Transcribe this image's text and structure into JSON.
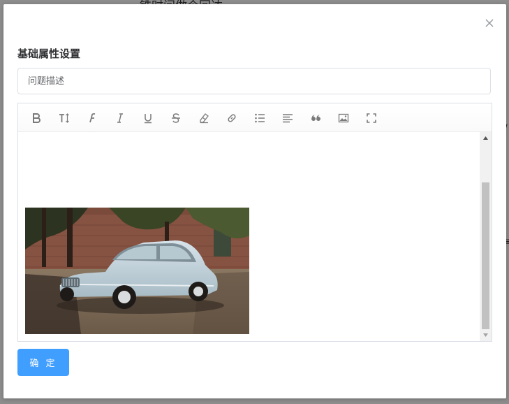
{
  "background": {
    "partial_text": "..."
  },
  "dialog": {
    "title": "基础属性设置",
    "description_placeholder": "问题描述",
    "confirm_label": "确 定"
  },
  "toolbar": {
    "buttons": [
      {
        "icon": "bold-icon"
      },
      {
        "icon": "text-height-icon"
      },
      {
        "icon": "font-icon"
      },
      {
        "icon": "italic-icon"
      },
      {
        "icon": "underline-icon"
      },
      {
        "icon": "strikethrough-icon"
      },
      {
        "icon": "eraser-icon"
      },
      {
        "icon": "link-icon"
      },
      {
        "icon": "list-icon"
      },
      {
        "icon": "align-icon"
      },
      {
        "icon": "quote-icon"
      },
      {
        "icon": "image-icon"
      },
      {
        "icon": "fullscreen-icon"
      }
    ]
  },
  "colors": {
    "primary": "#409eff",
    "title": "#303133",
    "border": "#dcdfe6"
  }
}
